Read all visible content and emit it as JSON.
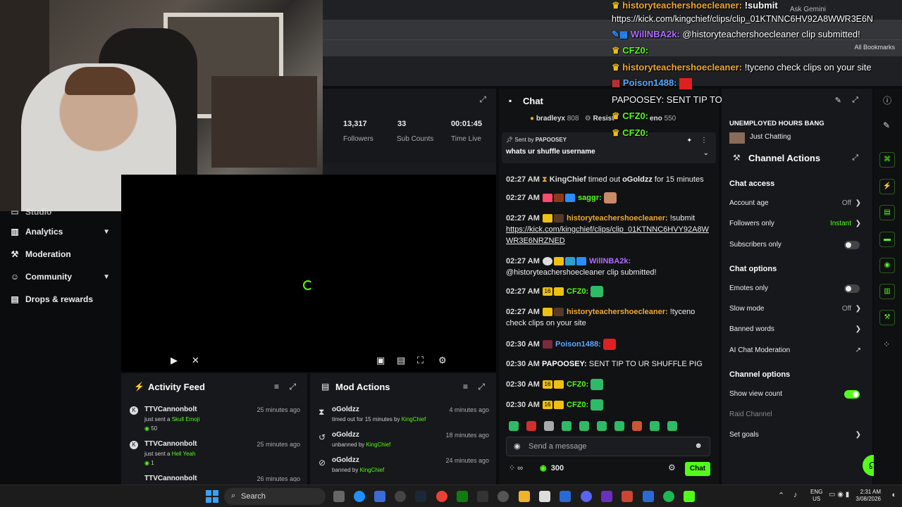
{
  "browser": {
    "ask_gemini": "Ask Gemini",
    "all_bookmarks": "All Bookmarks"
  },
  "left_nav": {
    "items": [
      {
        "label": "Studio",
        "icon": "studio-icon"
      },
      {
        "label": "Analytics",
        "icon": "chart-icon",
        "chevron": true
      },
      {
        "label": "Moderation",
        "icon": "hammer-icon"
      },
      {
        "label": "Community",
        "icon": "people-icon",
        "chevron": true
      },
      {
        "label": "Drops & rewards",
        "icon": "gift-icon"
      }
    ]
  },
  "stats": [
    {
      "value": "13,317",
      "label": "Followers"
    },
    {
      "value": "33",
      "label": "Sub Counts"
    },
    {
      "value": "00:01:45",
      "label": "Time Live"
    }
  ],
  "activity": {
    "title": "Activity Feed",
    "rows": [
      {
        "name": "TTVCannonbolt",
        "pre": "just sent a ",
        "item": "Skull Emoji",
        "amount": "50",
        "time": "25 minutes ago"
      },
      {
        "name": "TTVCannonbolt",
        "pre": "just sent a ",
        "item": "Hell Yeah",
        "amount": "1",
        "time": "25 minutes ago"
      },
      {
        "name": "TTVCannonbolt",
        "time": "26 minutes ago"
      }
    ]
  },
  "modactions": {
    "title": "Mod Actions",
    "rows": [
      {
        "name": "oGoldzz",
        "action": "timed out for 15 minutes by ",
        "by": "KingChief",
        "time": "4 minutes ago"
      },
      {
        "name": "oGoldzz",
        "action": "unbanned by ",
        "by": "KingChief",
        "time": "18 minutes ago"
      },
      {
        "name": "oGoldzz",
        "action": "banned by ",
        "by": "KingChief",
        "time": "24 minutes ago"
      }
    ]
  },
  "chat": {
    "title": "Chat",
    "gifters": [
      {
        "name": "bradleyx",
        "value": "808"
      },
      {
        "name": "Resist",
        "value": ""
      },
      {
        "name": "eno",
        "value": "550"
      }
    ],
    "pinned": {
      "sent_by_label": "Sent by ",
      "sent_by": "PAPOOSEY",
      "text": "whats ur shuffle username"
    },
    "messages": [
      {
        "time": "02:27 AM",
        "user": "KingChief",
        "text": " timed out ",
        "target": "oGoldzz",
        "suffix": " for 15 minutes"
      },
      {
        "time": "02:27 AM",
        "user": "saggr:",
        "color": "#53fc18"
      },
      {
        "time": "02:27 AM",
        "user": "historyteachershoecleaner:",
        "color": "#f0a830",
        "text": " !submit",
        "link": "https://kick.com/kingchief/clips/clip_01KTNNC6HVY92A8WWR3E6NRZNED"
      },
      {
        "time": "02:27 AM",
        "user": "WillNBA2k:",
        "color": "#b06cff",
        "text": "@historyteachershoecleaner clip submitted!"
      },
      {
        "time": "02:27 AM",
        "user": "CFZ0:",
        "color": "#53fc18"
      },
      {
        "time": "02:27 AM",
        "user": "historyteachershoecleaner:",
        "color": "#f0a830",
        "text": " !tyceno check clips on your site"
      },
      {
        "time": "02:30 AM",
        "user": "Poison1488:",
        "color": "#5aa8ff"
      },
      {
        "time": "02:30 AM",
        "user": "PAPOOSEY:",
        "color": "#ffffff",
        "text": " SENT TIP TO UR SHUFFLE PIG"
      },
      {
        "time": "02:30 AM",
        "user": "CFZ0:",
        "color": "#53fc18"
      },
      {
        "time": "02:30 AM",
        "user": "CFZ0:",
        "color": "#53fc18"
      }
    ],
    "input_placeholder": "Send a message",
    "points": "300",
    "chat_button": "Chat"
  },
  "overlay": {
    "l1_user": "historyteachershoecleaner:",
    "l1_text": "!submit",
    "l2_text": "https://kick.com/kingchief/clips/clip_01KTNNC6HV92A8WWR3E6N",
    "l3_user": "WillNBA2k:",
    "l3_text": "@historyteachershoecleaner clip submitted!",
    "l4_user": "CFZ0:",
    "l5_user": "historyteachershoecleaner:",
    "l5_text": "!tyceno check clips on your site",
    "l6_user": "Poison1488:",
    "l7_text": "PAPOOSEY: SENT TIP TO UR SHUFFLE PIG",
    "l8_user": "CFZ0:",
    "l9_user": "CFZ0:"
  },
  "stream_info": {
    "title": "UNEMPLOYED HOURS BANG",
    "category": "Just Chatting"
  },
  "channel_actions": {
    "title": "Channel Actions",
    "chat_access": "Chat access",
    "account_age": "Account age",
    "account_age_val": "Off",
    "followers_only": "Followers only",
    "followers_only_val": "Instant",
    "subscribers_only": "Subscribers only",
    "chat_options": "Chat options",
    "emotes_only": "Emotes only",
    "slow_mode": "Slow mode",
    "slow_mode_val": "Off",
    "banned_words": "Banned words",
    "ai_mod": "AI Chat Moderation",
    "channel_options": "Channel options",
    "show_view_count": "Show view count",
    "raid_channel": "Raid Channel",
    "set_goals": "Set goals"
  },
  "taskbar": {
    "search": "Search",
    "lang": "ENG",
    "region": "US",
    "time": "2:31 AM",
    "date": "3/08/2026"
  },
  "colors": {
    "accent": "#53fc18",
    "bg": "#0b0c0e",
    "panel": "#17181b"
  }
}
